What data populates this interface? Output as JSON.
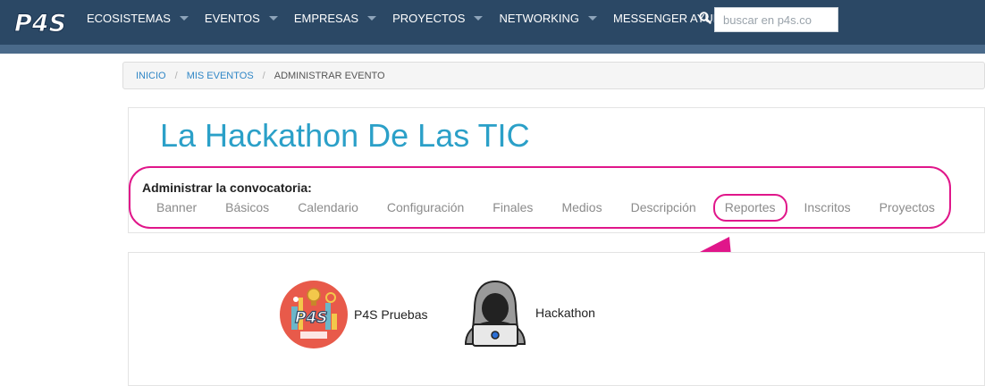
{
  "nav": {
    "logo_text": "P4S",
    "items": [
      {
        "label": "ECOSISTEMAS",
        "has_caret": true
      },
      {
        "label": "EVENTOS",
        "has_caret": true
      },
      {
        "label": "EMPRESAS",
        "has_caret": true
      },
      {
        "label": "PROYECTOS",
        "has_caret": true
      },
      {
        "label": "NETWORKING",
        "has_caret": true
      },
      {
        "label": "MESSENGER AYUDA",
        "has_caret": false
      }
    ],
    "search_placeholder": "buscar en p4s.co",
    "search_icon": "search-icon"
  },
  "breadcrumb": {
    "items": [
      "INICIO",
      "MIS EVENTOS"
    ],
    "current": "ADMINISTRAR EVENTO",
    "separator": "/"
  },
  "event": {
    "title": "La Hackathon De Las TIC",
    "manage_label": "Administrar la convocatoria:",
    "tabs": [
      "Banner",
      "Básicos",
      "Calendario",
      "Configuración",
      "Finales",
      "Medios",
      "Descripción",
      "Reportes",
      "Inscritos",
      "Proyectos"
    ],
    "highlighted_tab": "Reportes"
  },
  "organizations": [
    {
      "name": "P4S Pruebas",
      "icon": "p4s-logo-icon"
    },
    {
      "name": "Hackathon",
      "icon": "hacker-icon"
    }
  ],
  "colors": {
    "navbar": "#2b4865",
    "title": "#2ba0c8",
    "annotation": "#e0168a",
    "link": "#2f86c6"
  }
}
